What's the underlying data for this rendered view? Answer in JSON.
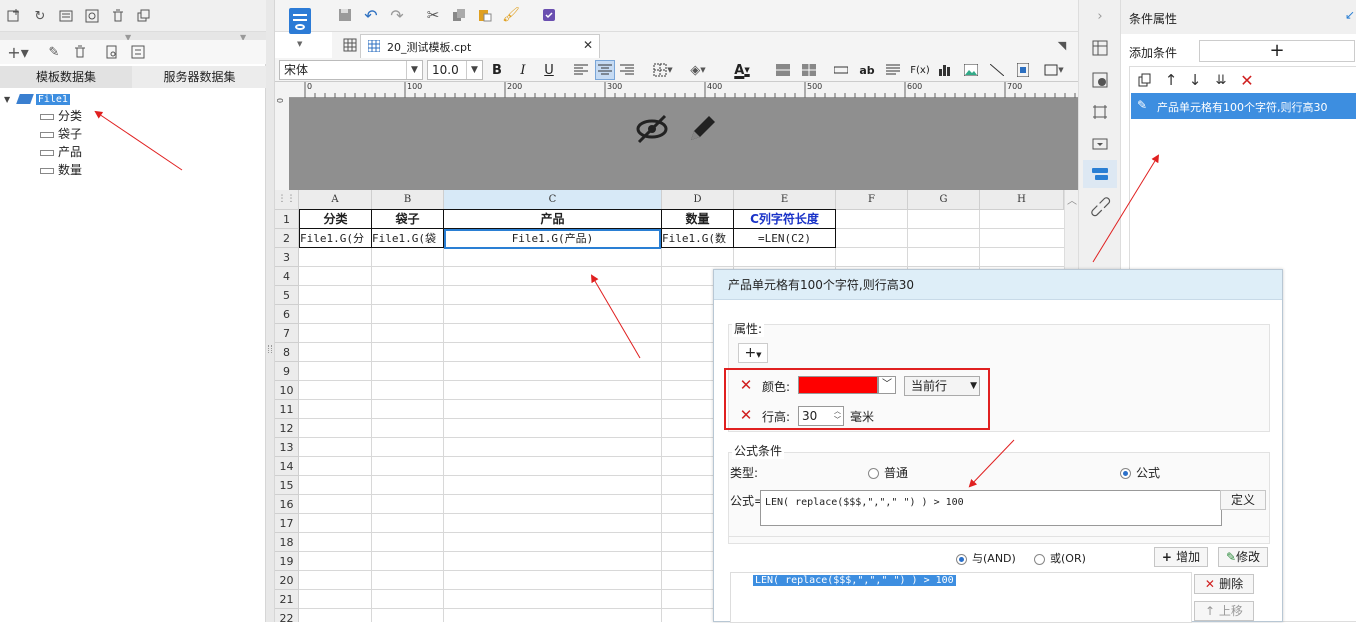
{
  "left_panel": {
    "tabs": [
      "模板数据集",
      "服务器数据集"
    ],
    "tree": {
      "root": "File1",
      "fields": [
        "分类",
        "袋子",
        "产品",
        "数量"
      ]
    }
  },
  "editor": {
    "file_tab": "20_测试模板.cpt",
    "font_name": "宋体",
    "font_size": "10.0",
    "ruler_ticks": [
      "0",
      "100",
      "200",
      "300",
      "400",
      "500",
      "600",
      "700"
    ],
    "columns": [
      "A",
      "B",
      "C",
      "D",
      "E",
      "F",
      "G",
      "H"
    ],
    "rows": [
      "1",
      "2",
      "3",
      "4",
      "5",
      "6",
      "7",
      "8",
      "9",
      "10",
      "11",
      "12",
      "13",
      "14",
      "15",
      "16",
      "17",
      "18",
      "19",
      "20",
      "21",
      "22"
    ],
    "row1": [
      "分类",
      "袋子",
      "产品",
      "数量",
      "C列字符长度"
    ],
    "row2": [
      "File1.G(分",
      "File1.G(袋",
      "File1.G(产品)",
      "File1.G(数",
      "=LEN(C2)"
    ]
  },
  "right_panel": {
    "title": "条件属性",
    "add_condition_label": "添加条件",
    "condition_item": "产品单元格有100个字符,则行高30"
  },
  "dialog": {
    "title": "产品单元格有100个字符,则行高30",
    "properties_label": "属性:",
    "color_label": "颜色:",
    "color_value": "#ff0000",
    "scope_value": "当前行",
    "row_height_label": "行高:",
    "row_height_value": "30",
    "row_height_unit": "毫米",
    "formula_section_label": "公式条件",
    "type_label": "类型:",
    "type_normal": "普通",
    "type_formula": "公式",
    "formula_label": "公式=",
    "formula_value": "LEN(  replace($$$,\",\",\" \")  ) > 100",
    "define_button": "定义",
    "and_label": "与(AND)",
    "or_label": "或(OR)",
    "add_button": "增加",
    "modify_button": "修改",
    "list_item": "LEN(  replace($$$,\",\",\" \")  ) > 100",
    "delete_button": "删除",
    "move_up_button": "上移"
  },
  "colors": {
    "accent": "#2a7fd4",
    "highlight": "#3d8ee0",
    "annotation": "#e02020"
  }
}
